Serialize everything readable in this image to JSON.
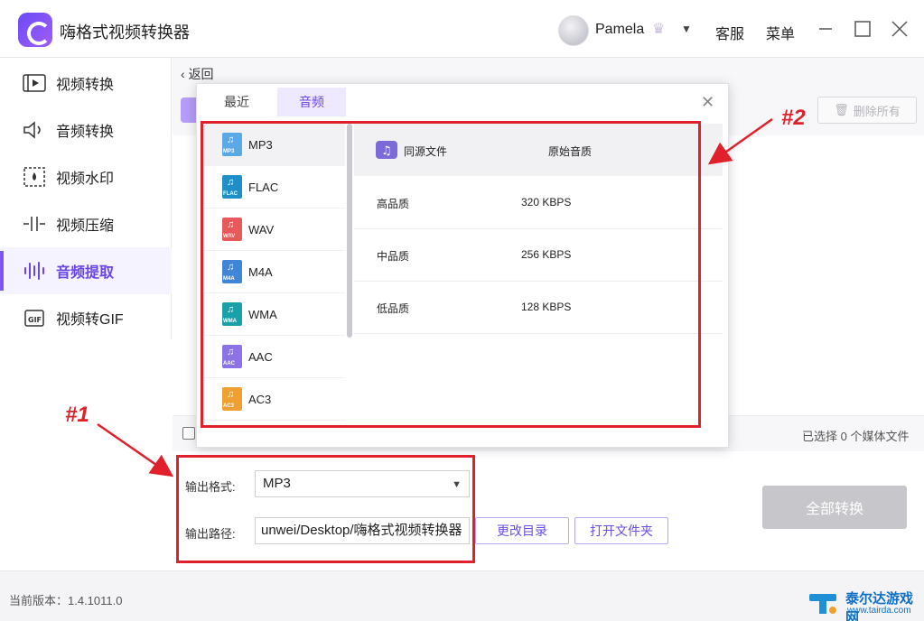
{
  "app": {
    "title": "嗨格式视频转换器"
  },
  "titlebar": {
    "username": "Pamela",
    "service": "客服",
    "menu": "菜单"
  },
  "sidebar": {
    "items": [
      {
        "label": "视频转换",
        "icon": "video-convert-icon"
      },
      {
        "label": "音频转换",
        "icon": "speaker-icon"
      },
      {
        "label": "视频水印",
        "icon": "watermark-icon"
      },
      {
        "label": "视频压缩",
        "icon": "compress-icon"
      },
      {
        "label": "音频提取",
        "icon": "waveform-icon",
        "active": true
      },
      {
        "label": "视频转GIF",
        "icon": "gif-icon"
      }
    ]
  },
  "main": {
    "back": "返回",
    "delete_all": "删除所有",
    "selected_count": "已选择 0 个媒体文件"
  },
  "popup": {
    "tabs": [
      {
        "label": "最近"
      },
      {
        "label": "音频",
        "active": true
      }
    ],
    "formats": [
      {
        "label": "MP3",
        "tag": "MP3",
        "color": "#5aa9e6",
        "selected": true
      },
      {
        "label": "FLAC",
        "tag": "FLAC",
        "color": "#1f8fc7"
      },
      {
        "label": "WAV",
        "tag": "WAV",
        "color": "#e85a5a"
      },
      {
        "label": "M4A",
        "tag": "M4A",
        "color": "#3f86d6"
      },
      {
        "label": "WMA",
        "tag": "WMA",
        "color": "#1aa0a8"
      },
      {
        "label": "AAC",
        "tag": "AAC",
        "color": "#8b73e6"
      },
      {
        "label": "AC3",
        "tag": "AC3",
        "color": "#f0a030"
      }
    ],
    "quality_header": {
      "name": "同源文件",
      "value": "原始音质"
    },
    "qualities": [
      {
        "name": "高品质",
        "value": "320 KBPS"
      },
      {
        "name": "中品质",
        "value": "256 KBPS"
      },
      {
        "name": "低品质",
        "value": "128 KBPS"
      }
    ]
  },
  "output": {
    "format_label": "输出格式:",
    "format_value": "MP3",
    "path_label": "输出路径:",
    "path_value": "unwei/Desktop/嗨格式视频转换器",
    "change_dir": "更改目录",
    "open_folder": "打开文件夹",
    "convert_all": "全部转换"
  },
  "status": {
    "version": "当前版本：1.4.1011.0"
  },
  "annotations": {
    "one": "#1",
    "two": "#2"
  },
  "watermark": {
    "name": "泰尔达游戏网",
    "url": "www.tairda.com"
  },
  "colors": {
    "accent": "#6a45e8",
    "annotation": "#e0202a"
  }
}
